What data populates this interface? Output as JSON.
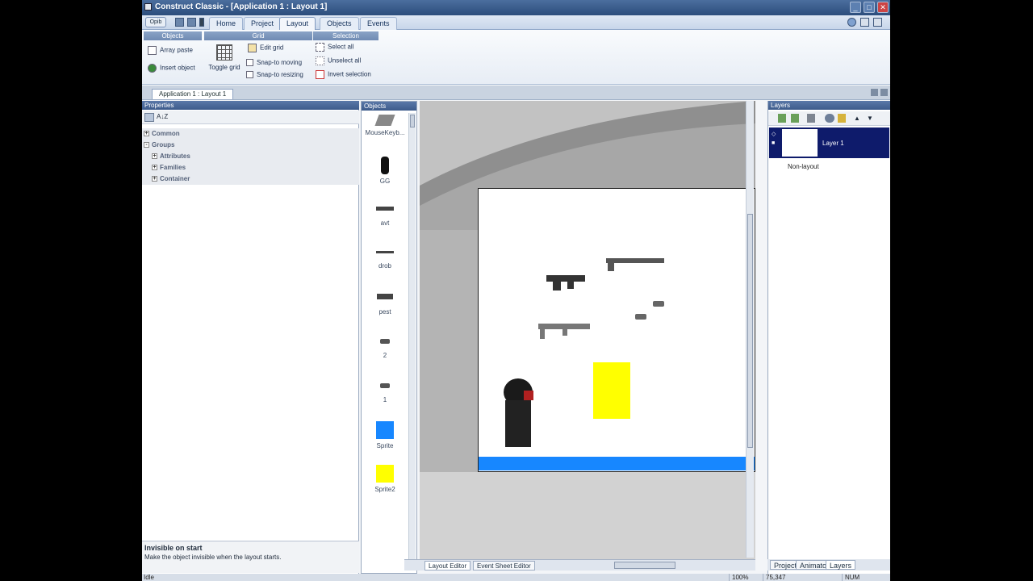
{
  "window": {
    "title": "Construct Classic - [Application 1 : Layout 1]"
  },
  "titlebar_buttons": [
    "_",
    "□",
    "✕"
  ],
  "ribbon": {
    "orb_label": "Орib",
    "tabs": [
      "Home",
      "Project",
      "Layout",
      "Objects",
      "Events"
    ],
    "active_tab": "Layout",
    "groups": {
      "objects": {
        "header": "Objects",
        "array_paste": "Array paste",
        "insert_object": "Insert object",
        "toggle_grid": "Toggle grid"
      },
      "grid": {
        "header": "Grid",
        "edit_grid": "Edit grid",
        "snap_moving": "Snap-to moving",
        "snap_resizing": "Snap-to resizing"
      },
      "selection": {
        "header": "Selection",
        "select_all": "Select all",
        "unselect_all": "Unselect all",
        "invert_selection": "Invert selection"
      }
    }
  },
  "doc_tab": "Application 1 : Layout 1",
  "properties": {
    "header": "Properties",
    "sort_label": "A↓Z",
    "rows": [
      {
        "label": "Common",
        "indent": false
      },
      {
        "label": "Groups",
        "indent": false
      },
      {
        "label": "Attributes",
        "indent": true
      },
      {
        "label": "Families",
        "indent": true
      },
      {
        "label": "Container",
        "indent": true
      }
    ],
    "desc_title": "Invisible on start",
    "desc_text": "Make the object invisible when the layout starts."
  },
  "objects_panel": {
    "header": "Objects",
    "items": [
      {
        "label": "MouseKeyb...",
        "icon": "keyboard-icon"
      },
      {
        "label": "GG",
        "icon": "character-icon"
      },
      {
        "label": "avt",
        "icon": "rifle-icon"
      },
      {
        "label": "drob",
        "icon": "shotgun-icon"
      },
      {
        "label": "pest",
        "icon": "pistol-icon"
      },
      {
        "label": "2",
        "icon": "ammo-icon"
      },
      {
        "label": "1",
        "icon": "ammo-icon"
      },
      {
        "label": "Sprite",
        "icon": "blue-box",
        "color": "#1787ff"
      },
      {
        "label": "Sprite2",
        "icon": "yellow-box",
        "color": "#ffff00"
      }
    ]
  },
  "editor_tabs": [
    "Layout Editor",
    "Event Sheet Editor"
  ],
  "layers": {
    "header": "Layers",
    "selected": "Layer 1",
    "other": "Non-layout",
    "tabs": [
      "Project",
      "Animator",
      "Layers"
    ],
    "active_tab": "Layers"
  },
  "status": {
    "left": "Idle",
    "zoom": "100%",
    "coords": "75,347",
    "num": "NUM"
  },
  "colors": {
    "blue_sprite": "#1787ff",
    "yellow_sprite": "#ffff00",
    "layer_selected": "#0e1b6b"
  }
}
